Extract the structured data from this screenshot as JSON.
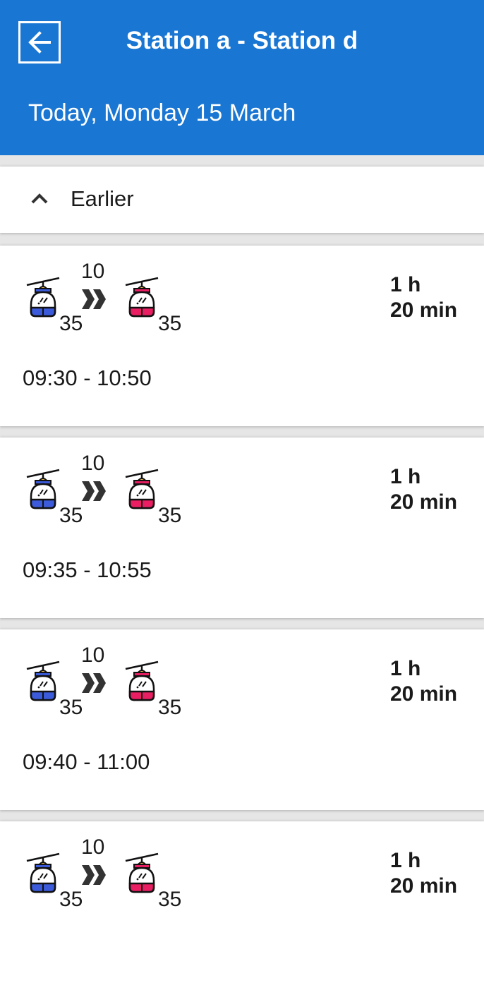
{
  "header": {
    "title": "Station a - Station d",
    "date": "Today, Monday 15 March",
    "back_icon": "arrow-left-icon"
  },
  "earlier": {
    "label": "Earlier",
    "icon": "chevron-up-icon"
  },
  "colors": {
    "header_bg": "#1976d2",
    "line1": "#3b5bdb",
    "line2": "#e91e63",
    "gondola_roof": "#f5c84c"
  },
  "connections": [
    {
      "leg1_line": "35",
      "transfer_wait": "10",
      "leg2_line": "35",
      "duration_h": "1 h",
      "duration_min": "20 min",
      "times": "09:30 - 10:50"
    },
    {
      "leg1_line": "35",
      "transfer_wait": "10",
      "leg2_line": "35",
      "duration_h": "1 h",
      "duration_min": "20 min",
      "times": "09:35 - 10:55"
    },
    {
      "leg1_line": "35",
      "transfer_wait": "10",
      "leg2_line": "35",
      "duration_h": "1 h",
      "duration_min": "20 min",
      "times": "09:40 - 11:00"
    },
    {
      "leg1_line": "35",
      "transfer_wait": "10",
      "leg2_line": "35",
      "duration_h": "1 h",
      "duration_min": "20 min",
      "times": ""
    }
  ]
}
